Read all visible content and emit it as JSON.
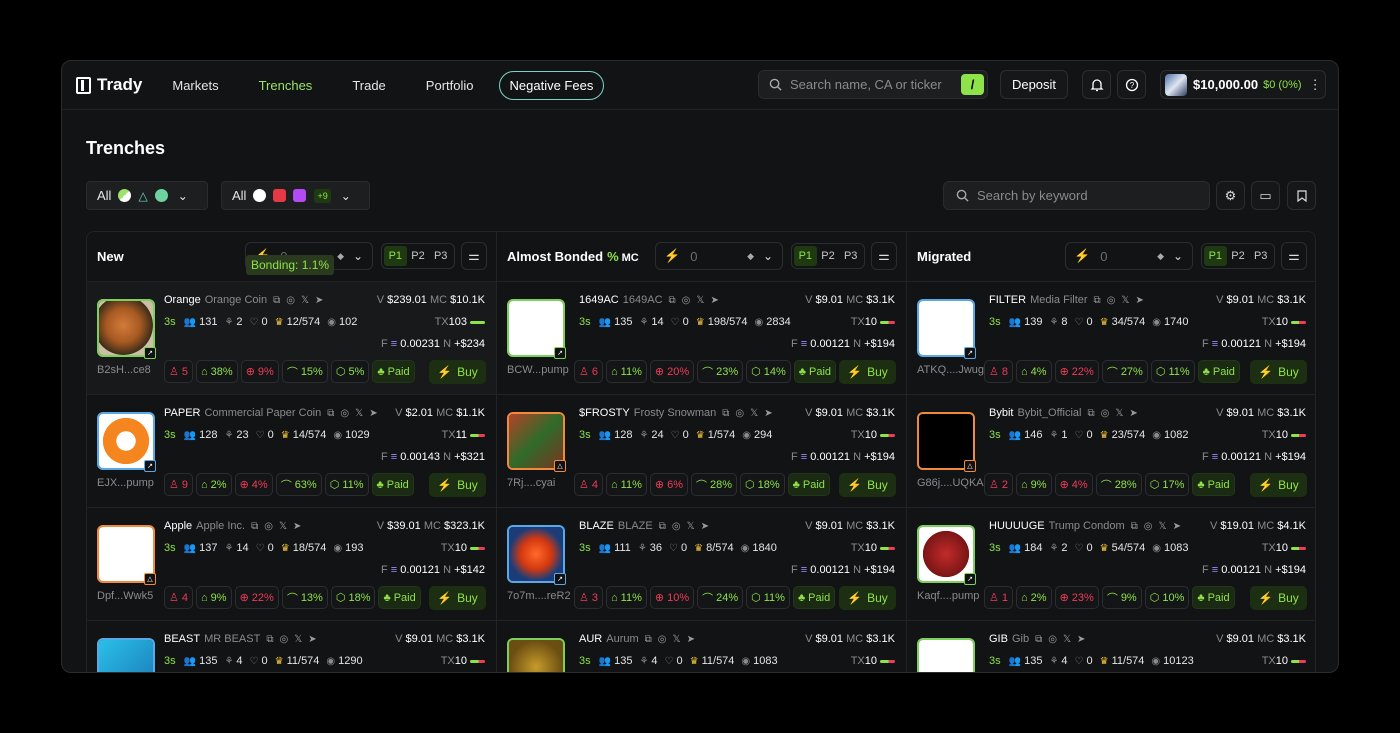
{
  "app": {
    "name": "Trady"
  },
  "nav": {
    "items": [
      "Markets",
      "Trenches",
      "Trade",
      "Portfolio"
    ],
    "active": "Trenches",
    "promo": "Negative Fees"
  },
  "search": {
    "placeholder": "Search name, CA or ticker",
    "shortcut": "/"
  },
  "deposit_label": "Deposit",
  "wallet": {
    "balance": "$10,000.00",
    "pnl": "$0 (0%)"
  },
  "page_title": "Trenches",
  "filters": {
    "left_label": "All",
    "right_label": "All",
    "right_more": "+9",
    "keyword_placeholder": "Search by keyword"
  },
  "colors": {
    "accent": "#8ee34a",
    "danger": "#ef3b5a",
    "bg": "#121314"
  },
  "tooltip": "Bonding: 1.1%",
  "columns": [
    {
      "title": "New",
      "pct": "",
      "mc": "",
      "amount": "0",
      "pages": [
        "P1",
        "P2",
        "P3"
      ],
      "cards": [
        {
          "ticker": "Orange",
          "name": "Orange Coin",
          "addr": "B2sH...ce8",
          "v": "$239.01",
          "mc": "$10.1K",
          "age": "3s",
          "holders": "131",
          "snipers": "2",
          "insiders": "0",
          "top": "12/574",
          "views": "102",
          "tx": "103",
          "f": "0.00231",
          "n": "+$234",
          "p1": "5",
          "p2": "38%",
          "p3": "9%",
          "p4": "15%",
          "p5": "5%",
          "paid": "Paid",
          "buy": "Buy",
          "img": "orange",
          "badge": "pump",
          "border": "#7fcf5c",
          "hl": true
        },
        {
          "ticker": "PAPER",
          "name": "Commercial Paper Coin",
          "addr": "EJX...pump",
          "v": "$2.01",
          "mc": "$1.1K",
          "age": "3s",
          "holders": "128",
          "snipers": "23",
          "insiders": "0",
          "top": "14/574",
          "views": "1029",
          "tx": "11",
          "f": "0.00143",
          "n": "+$321",
          "p1": "9",
          "p2": "2%",
          "p3": "4%",
          "p4": "63%",
          "p5": "11%",
          "paid": "Paid",
          "buy": "Buy",
          "img": "paper",
          "badge": "bonk",
          "border": "#5aa9e6"
        },
        {
          "ticker": "Apple",
          "name": "Apple Inc.",
          "addr": "Dpf...Wwk5",
          "v": "$39.01",
          "mc": "$323.1K",
          "age": "3s",
          "holders": "137",
          "snipers": "14",
          "insiders": "0",
          "top": "18/574",
          "views": "193",
          "tx": "10",
          "f": "0.00121",
          "n": "+$142",
          "p1": "4",
          "p2": "9%",
          "p3": "22%",
          "p4": "13%",
          "p5": "18%",
          "paid": "Paid",
          "buy": "Buy",
          "img": "apple",
          "badge": "launch",
          "border": "#f08a3c"
        },
        {
          "ticker": "BEAST",
          "name": "MR BEAST",
          "addr": "",
          "v": "$9.01",
          "mc": "$3.1K",
          "age": "3s",
          "holders": "135",
          "snipers": "4",
          "insiders": "0",
          "top": "11/574",
          "views": "1290",
          "tx": "10",
          "f": "",
          "n": "",
          "p1": "",
          "p2": "",
          "p3": "",
          "p4": "",
          "p5": "",
          "paid": "",
          "buy": "",
          "img": "beast",
          "badge": "",
          "border": "#5aa9e6"
        }
      ]
    },
    {
      "title": "Almost Bonded",
      "pct": "%",
      "mc": "MC",
      "amount": "0",
      "pages": [
        "P1",
        "P2",
        "P3"
      ],
      "cards": [
        {
          "ticker": "1649AC",
          "name": "1649AC",
          "addr": "BCW...pump",
          "v": "$9.01",
          "mc": "$3.1K",
          "age": "3s",
          "holders": "135",
          "snipers": "14",
          "insiders": "0",
          "top": "198/574",
          "views": "2834",
          "tx": "10",
          "f": "0.00121",
          "n": "+$194",
          "p1": "6",
          "p2": "11%",
          "p3": "20%",
          "p4": "23%",
          "p5": "14%",
          "paid": "Paid",
          "buy": "Buy",
          "img": "1649",
          "badge": "pump",
          "border": "#7fcf5c"
        },
        {
          "ticker": "$FROSTY",
          "name": "Frosty Snowman",
          "addr": "7Rj....cyai",
          "v": "$9.01",
          "mc": "$3.1K",
          "age": "3s",
          "holders": "128",
          "snipers": "24",
          "insiders": "0",
          "top": "1/574",
          "views": "294",
          "tx": "10",
          "f": "0.00121",
          "n": "+$194",
          "p1": "4",
          "p2": "11%",
          "p3": "6%",
          "p4": "28%",
          "p5": "18%",
          "paid": "Paid",
          "buy": "Buy",
          "img": "frosty",
          "badge": "launch",
          "border": "#f08a3c"
        },
        {
          "ticker": "BLAZE",
          "name": "BLAZE",
          "addr": "7o7m....reR2",
          "v": "$9.01",
          "mc": "$3.1K",
          "age": "3s",
          "holders": "111",
          "snipers": "36",
          "insiders": "0",
          "top": "8/574",
          "views": "1840",
          "tx": "10",
          "f": "0.00121",
          "n": "+$194",
          "p1": "3",
          "p2": "11%",
          "p3": "10%",
          "p4": "24%",
          "p5": "11%",
          "paid": "Paid",
          "buy": "Buy",
          "img": "blaze",
          "badge": "bonk",
          "border": "#5aa9e6"
        },
        {
          "ticker": "AUR",
          "name": "Aurum",
          "addr": "",
          "v": "$9.01",
          "mc": "$3.1K",
          "age": "3s",
          "holders": "135",
          "snipers": "4",
          "insiders": "0",
          "top": "11/574",
          "views": "1083",
          "tx": "10",
          "f": "",
          "n": "",
          "p1": "",
          "p2": "",
          "p3": "",
          "p4": "",
          "p5": "",
          "paid": "",
          "buy": "",
          "img": "aur",
          "badge": "",
          "border": "#7fcf5c"
        }
      ]
    },
    {
      "title": "Migrated",
      "pct": "",
      "mc": "",
      "amount": "0",
      "pages": [
        "P1",
        "P2",
        "P3"
      ],
      "cards": [
        {
          "ticker": "FILTER",
          "name": "Media Filter",
          "addr": "ATKQ....Jwug",
          "v": "$9.01",
          "mc": "$3.1K",
          "age": "3s",
          "holders": "139",
          "snipers": "8",
          "insiders": "0",
          "top": "34/574",
          "views": "1740",
          "tx": "10",
          "f": "0.00121",
          "n": "+$194",
          "p1": "8",
          "p2": "4%",
          "p3": "22%",
          "p4": "27%",
          "p5": "11%",
          "paid": "Paid",
          "buy": "Buy",
          "img": "filter",
          "badge": "bonk",
          "border": "#5aa9e6"
        },
        {
          "ticker": "Bybit",
          "name": "Bybit_Official",
          "addr": "G86j....UQKA",
          "v": "$9.01",
          "mc": "$3.1K",
          "age": "3s",
          "holders": "146",
          "snipers": "1",
          "insiders": "0",
          "top": "23/574",
          "views": "1082",
          "tx": "10",
          "f": "0.00121",
          "n": "+$194",
          "p1": "2",
          "p2": "9%",
          "p3": "4%",
          "p4": "28%",
          "p5": "17%",
          "paid": "Paid",
          "buy": "Buy",
          "img": "bybit",
          "badge": "launch",
          "border": "#f08a3c"
        },
        {
          "ticker": "HUUUUGE",
          "name": "Trump Condom",
          "addr": "Kaqf....pump",
          "v": "$19.01",
          "mc": "$4.1K",
          "age": "3s",
          "holders": "184",
          "snipers": "2",
          "insiders": "0",
          "top": "54/574",
          "views": "1083",
          "tx": "10",
          "f": "0.00121",
          "n": "+$194",
          "p1": "1",
          "p2": "2%",
          "p3": "23%",
          "p4": "9%",
          "p5": "10%",
          "paid": "Paid",
          "buy": "Buy",
          "img": "huge",
          "badge": "pump",
          "border": "#7fcf5c"
        },
        {
          "ticker": "GIB",
          "name": "Gib",
          "addr": "",
          "v": "$9.01",
          "mc": "$3.1K",
          "age": "3s",
          "holders": "135",
          "snipers": "4",
          "insiders": "0",
          "top": "11/574",
          "views": "10123",
          "tx": "10",
          "f": "",
          "n": "",
          "p1": "",
          "p2": "",
          "p3": "",
          "p4": "",
          "p5": "",
          "paid": "",
          "buy": "",
          "img": "gib",
          "badge": "",
          "border": "#7fcf5c"
        }
      ]
    }
  ]
}
